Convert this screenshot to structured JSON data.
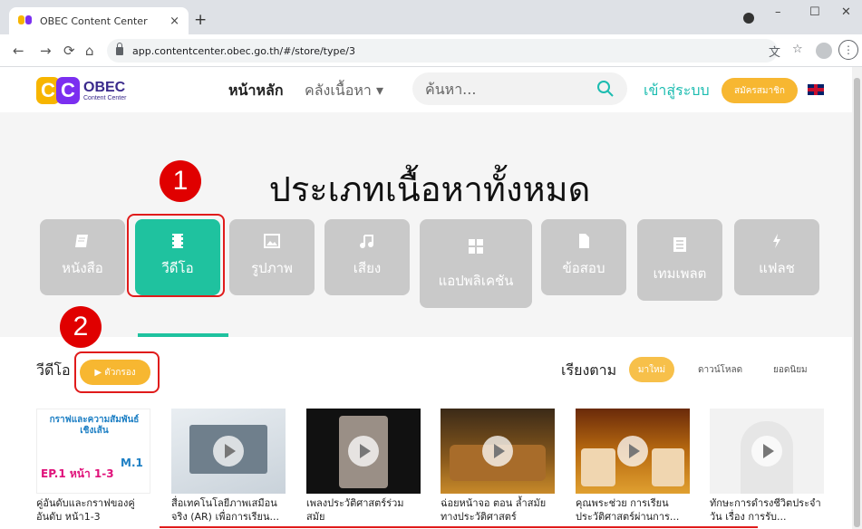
{
  "browser": {
    "tab_title": "OBEC Content Center",
    "tab_close": "×",
    "new_tab": "+",
    "url": "app.contentcenter.obec.go.th/#/store/type/3",
    "minimize": "–",
    "maximize": "☐",
    "close": "✕"
  },
  "header": {
    "logo_c1": "C",
    "logo_c2": "C",
    "logo_name": "OBEC",
    "logo_sub": "Content Center",
    "nav_home": "หน้าหลัก",
    "nav_library": "คลังเนื้อหา ▾",
    "search_placeholder": "ค้นหา...",
    "login": "เข้าสู่ระบบ",
    "register": "สมัครสมาชิก"
  },
  "hero": {
    "title": "ประเภทเนื้อหาทั้งหมด",
    "categories": [
      {
        "label": "หนังสือ",
        "icon": "book-icon"
      },
      {
        "label": "วีดีโอ",
        "icon": "film-icon",
        "active": true
      },
      {
        "label": "รูปภาพ",
        "icon": "image-icon"
      },
      {
        "label": "เสียง",
        "icon": "music-icon"
      },
      {
        "label": "แอปพลิเคชัน",
        "icon": "apps-icon"
      },
      {
        "label": "ข้อสอบ",
        "icon": "file-icon"
      },
      {
        "label": "เทมเพลต",
        "icon": "template-icon"
      },
      {
        "label": "แฟลช",
        "icon": "flash-icon"
      }
    ]
  },
  "annotations": {
    "step1": "1",
    "step2": "2"
  },
  "content": {
    "section_title": "วีดีโอ",
    "filter_label": "▶ ตัวกรอง",
    "sort_label": "เรียงตาม",
    "sort_options": [
      "มาใหม่",
      "ดาวน์โหลด",
      "ยอดนิยม"
    ],
    "cards": [
      {
        "title": "คู่อันดับและกราฟของคู่อันดับ หน้า1-3",
        "thumb_text1": "กราฟและความสัมพันธ์เชิงเส้น",
        "thumb_text2": "EP.1 หน้า 1-3",
        "thumb_text3": "M.1"
      },
      {
        "title": "สื่อเทคโนโลยีภาพเสมือนจริง (AR) เพื่อการเรียน..."
      },
      {
        "title": "เพลงประวัติศาสตร์ร่วมสมัย"
      },
      {
        "title": "ฉ่อยหน้าจอ ตอน ล้ำสมัยทางประวัติศาสตร์"
      },
      {
        "title": "คุณพระช่วย การเรียนประวัติศาสตร์ผ่านการ..."
      },
      {
        "title": "ทักษะการดำรงชีวิตประจำวัน เรื่อง การรับ..."
      }
    ]
  },
  "colors": {
    "accent_green": "#1fc29f",
    "accent_orange": "#f7b731",
    "annotation_red": "#e01b1b"
  }
}
